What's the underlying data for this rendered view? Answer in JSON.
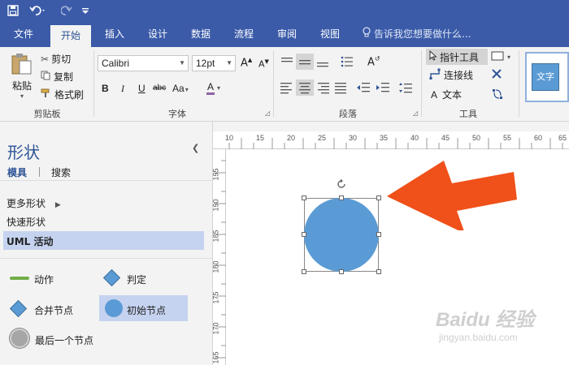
{
  "quick_access": {
    "save_icon": "save-icon",
    "undo_icon": "undo-icon",
    "redo_icon": "redo-icon",
    "customize_icon": "customize-icon"
  },
  "tabs": [
    "文件",
    "开始",
    "插入",
    "设计",
    "数据",
    "流程",
    "审阅",
    "视图"
  ],
  "active_tab": "开始",
  "tell_me": "告诉我您想要做什么...",
  "clipboard": {
    "paste": "粘贴",
    "cut": "剪切",
    "copy": "复制",
    "format_painter": "格式刷",
    "label": "剪贴板"
  },
  "font": {
    "name": "Calibri",
    "size": "12pt",
    "bold": "B",
    "italic": "I",
    "underline": "U",
    "strike": "abc",
    "case": "Aa",
    "color": "A",
    "label": "字体"
  },
  "paragraph": {
    "label": "段落"
  },
  "tools": {
    "pointer": "指针工具",
    "connector": "连接线",
    "text": "文本",
    "label": "工具"
  },
  "style_preview": "文字",
  "shapes_panel": {
    "title": "形状",
    "tab_stencils": "模具",
    "tab_search": "搜索",
    "more_shapes": "更多形状",
    "quick_shapes": "快速形状",
    "uml_activity": "UML 活动",
    "items": [
      "动作",
      "判定",
      "合并节点",
      "初始节点",
      "最后一个节点"
    ]
  },
  "ruler": {
    "horizontal": [
      "10",
      "15",
      "20",
      "25",
      "30",
      "35",
      "40",
      "45",
      "50",
      "55",
      "60",
      "65"
    ],
    "vertical": [
      "195",
      "190",
      "185",
      "180",
      "175",
      "170",
      "165"
    ]
  },
  "colors": {
    "titlebar": "#3b5ba9",
    "accent": "#2f5496",
    "shape_fill": "#5b9bd5",
    "arrow": "#f05019",
    "action_line": "#70ad47",
    "selection": "#c5d3f0"
  },
  "watermark": {
    "brand": "Baidu 经验",
    "url": "jingyan.baidu.com"
  }
}
